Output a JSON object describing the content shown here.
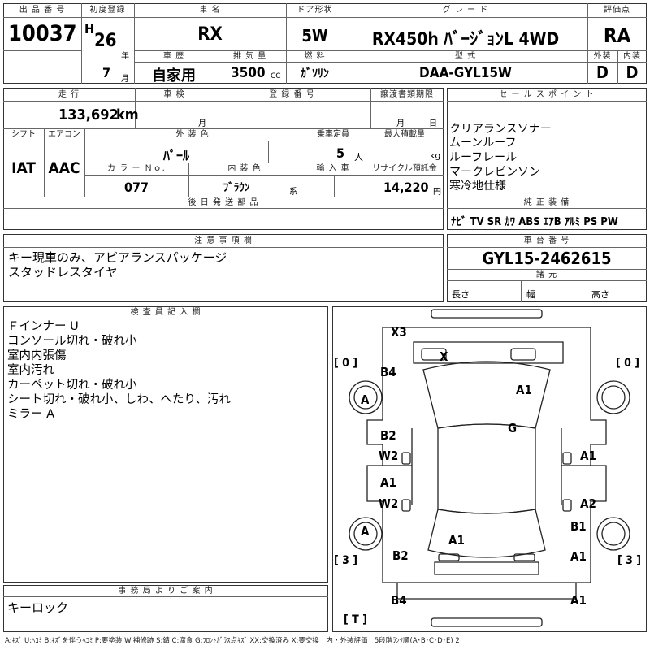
{
  "headers": {
    "lot_no": "出 品 番 号",
    "first_reg": "初度登録",
    "model": "車 名",
    "doors": "ドア形状",
    "grade": "グ レ ー ド",
    "score": "評価点",
    "history": "車 歴",
    "displacement": "排 気 量",
    "fuel": "燃 料",
    "type": "型 式",
    "exterior": "外装",
    "interior": "内装",
    "mileage": "走 行",
    "inspection": "車 検",
    "reg_no": "登 録 番 号",
    "transfer_due": "譲渡書類期限",
    "shift": "シフト",
    "ac": "エアコン",
    "color": "外 装 色",
    "capacity": "乗車定員",
    "max_load": "最大積載量",
    "color_no": "カ ラ ー Ｎｏ.",
    "int_color": "内 装 色",
    "import": "輸 入 車",
    "recycle": "リサイクル預託金",
    "later_parts": "後 日 発 送 部 品",
    "sales_points": "セ ー ル ス ポ イ ン ト",
    "equipment": "純 正 装 備",
    "notes": "注 意 事 項 欄",
    "chassis": "車 台 番 号",
    "dimensions": "諸 元",
    "inspector": "検 査 員 記 入 欄",
    "office": "事 務 局 よ り ご 案 内"
  },
  "values": {
    "lot_no": "10037",
    "era": "H",
    "year": "26",
    "year_unit": "年",
    "month": "7",
    "month_unit": "月",
    "model": "RX",
    "doors": "5W",
    "grade": "RX450h ﾊﾞｰｼﾞｮﾝL 4WD",
    "score": "RA",
    "history": "自家用",
    "displacement": "3500",
    "cc": "CC",
    "fuel": "ｶﾞｿﾘﾝ",
    "type": "DAA-GYL15W",
    "exterior": "D",
    "interior": "D",
    "mileage": "133,692",
    "km": "km",
    "insp_month": "月",
    "reg_month": "月",
    "reg_day": "日",
    "shift": "IAT",
    "ac": "AAC",
    "color": "ﾊﾟｰﾙ",
    "capacity": "5",
    "capacity_unit": "人",
    "kg": "kg",
    "color_no": "077",
    "int_color": "ﾌﾞﾗｳﾝ",
    "kei": "系",
    "recycle": "14,220",
    "yen": "円",
    "chassis": "GYL15-2462615",
    "length": "長さ",
    "width": "幅",
    "height": "高さ"
  },
  "sales_points": [
    "クリアランスソナー",
    "ムーンルーフ",
    "ルーフレール",
    "マークレビンソン",
    "寒冷地仕様"
  ],
  "equipment": "ﾅﾋﾞ TV SR ｶﾜ ABS ｴｱB ｱﾙﾐ PS PW",
  "notes": [
    "キー現車のみ、アピアランスパッケージ",
    "スタッドレスタイヤ"
  ],
  "inspector_notes": [
    "Ｆインナー U",
    "コンソール切れ・破れ小",
    "室内内張傷",
    "室内汚れ",
    "カーペット切れ・破れ小",
    "シート切れ・破れ小、しわ、へたり、汚れ",
    "ミラー A"
  ],
  "office_notes": [
    "キーロック"
  ],
  "diagram": {
    "tire_fl": "[ 0 ]",
    "tire_fr": "[ 0 ]",
    "tire_rl": "[ 3 ]",
    "tire_rr": "[ 3 ]",
    "spare": "[ T ]",
    "marks": [
      "X3",
      "X",
      "B4",
      "A1",
      "A",
      "A",
      "G",
      "B2",
      "W2",
      "A1",
      "A1",
      "W2",
      "A2",
      "B1",
      "A1",
      "A",
      "B2",
      "A1",
      "B4",
      "A1"
    ]
  },
  "legend": "A:ｷｽﾞ U:ﾍｺﾐ B:ｷｽﾞを伴うﾍｺﾐ P:要塗装 W:補修跡 S:錆 C:腐食 G:ﾌﾛﾝﾄｶﾞﾗｽ点ｷｽﾞ XX:交換済み X:要交換　内・外装評価　5段階ﾗﾝｸ順(A･B･C･D･E) 2"
}
